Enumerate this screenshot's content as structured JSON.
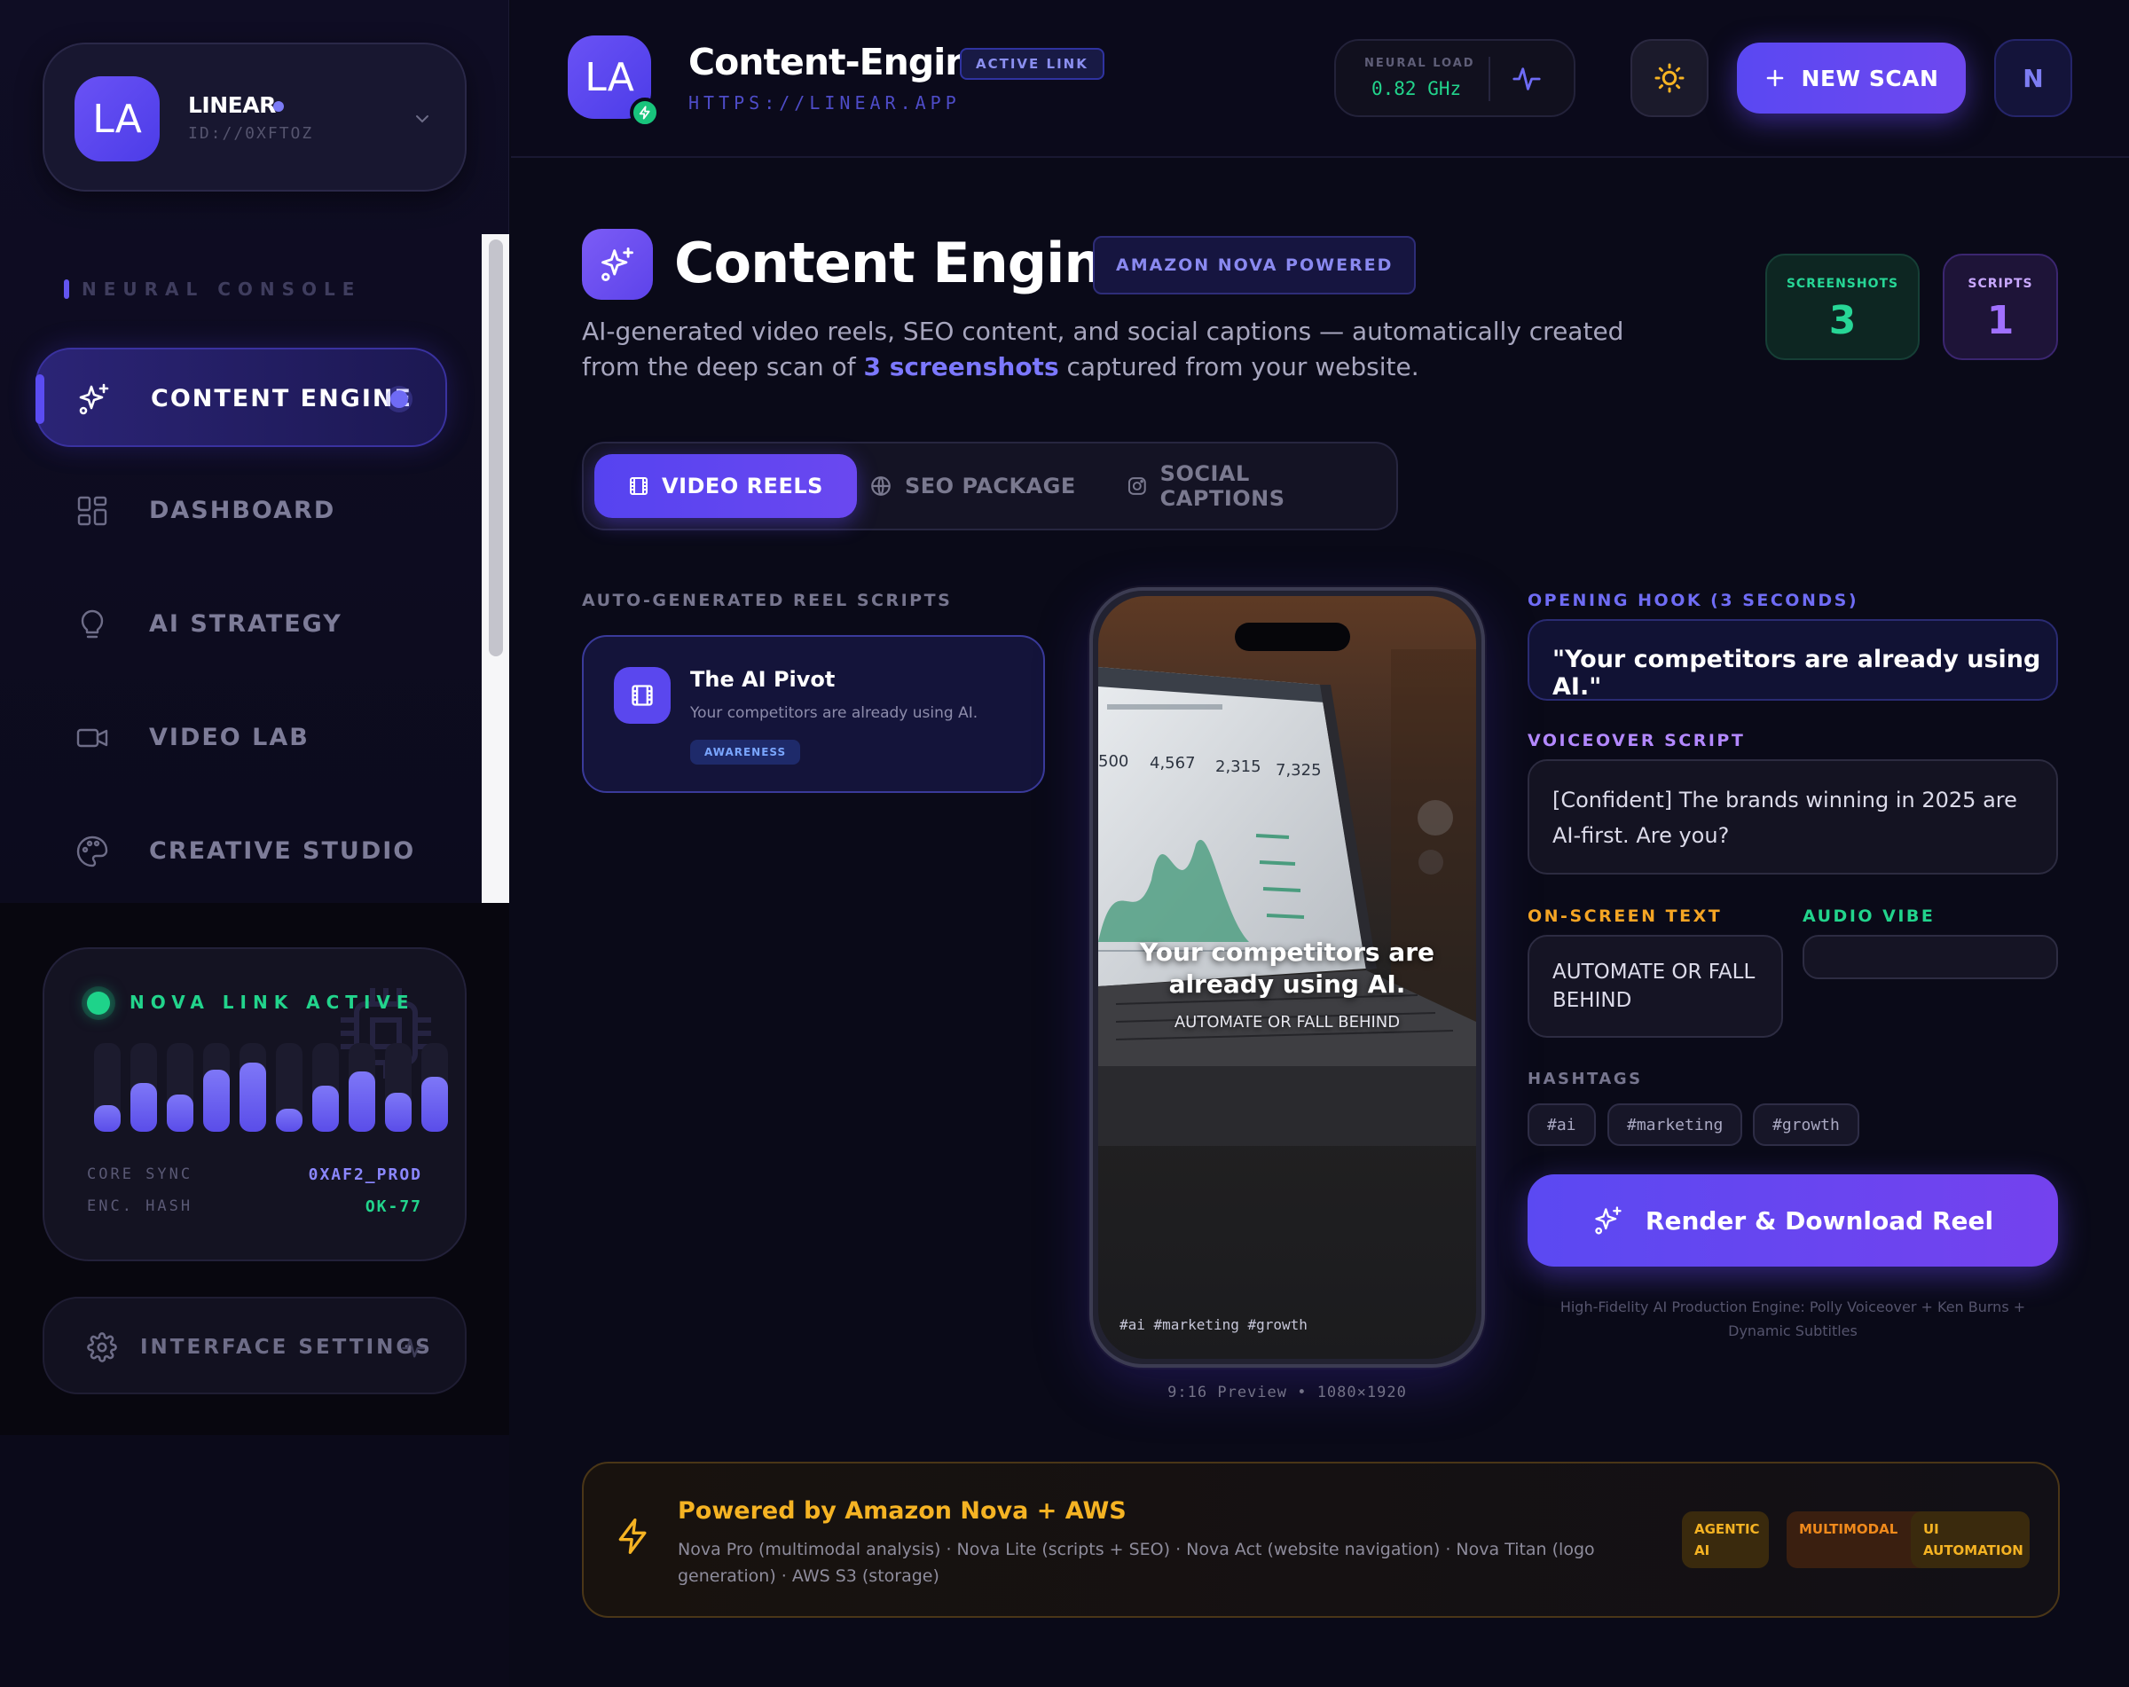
{
  "workspace": {
    "initials": "LA",
    "name": "LINEAR",
    "id": "ID://0XFTOZ"
  },
  "nav": {
    "heading": "NEURAL CONSOLE",
    "items": [
      {
        "label": "CONTENT ENGINE",
        "icon": "sparkles-icon",
        "active": true
      },
      {
        "label": "DASHBOARD",
        "icon": "grid-icon"
      },
      {
        "label": "AI STRATEGY",
        "icon": "lightbulb-icon"
      },
      {
        "label": "VIDEO LAB",
        "icon": "video-camera-icon"
      },
      {
        "label": "CREATIVE STUDIO",
        "icon": "palette-icon"
      }
    ]
  },
  "nova": {
    "status": "NOVA LINK ACTIVE",
    "levels": [
      0.3,
      0.55,
      0.42,
      0.7,
      0.78,
      0.26,
      0.52,
      0.68,
      0.44,
      0.62
    ],
    "rows": [
      {
        "key": "CORE SYNC",
        "value": "0XAF2_PROD",
        "color": "#8b87ff"
      },
      {
        "key": "ENC. HASH",
        "value": "OK-77",
        "color": "#22d48c"
      }
    ]
  },
  "settings": {
    "label": "INTERFACE SETTINGS"
  },
  "topbar": {
    "initials": "LA",
    "title": "Content-Engine",
    "status_pill": "ACTIVE LINK",
    "url": "HTTPS://LINEAR.APP",
    "neural_load_label": "NEURAL LOAD",
    "neural_load_value": "0.82 GHz",
    "new_scan_label": "NEW SCAN",
    "user_initial": "N"
  },
  "hero": {
    "title": "Content Engine",
    "pill": "AMAZON NOVA POWERED",
    "desc_before": "AI-generated video reels, SEO content, and social captions — automatically created from the deep scan of ",
    "desc_highlight": "3 screenshots",
    "desc_after": " captured from your website.",
    "stats": [
      {
        "label": "SCREENSHOTS",
        "value": "3"
      },
      {
        "label": "SCRIPTS",
        "value": "1"
      }
    ]
  },
  "tabs": [
    {
      "label": "VIDEO REELS",
      "icon": "film-icon",
      "active": true
    },
    {
      "label": "SEO PACKAGE",
      "icon": "globe-icon"
    },
    {
      "label": "SOCIAL CAPTIONS",
      "icon": "instagram-icon"
    }
  ],
  "scripts": {
    "heading": "AUTO-GENERATED REEL SCRIPTS",
    "items": [
      {
        "title": "The AI Pivot",
        "subtitle": "Your competitors are already using AI.",
        "tag": "AWARENESS"
      }
    ]
  },
  "preview": {
    "dashboard_numbers": [
      "500",
      "4,567",
      "2,315",
      "7,325"
    ],
    "overlay_title": "Your competitors are already using AI.",
    "overlay_sub": "AUTOMATE OR FALL BEHIND",
    "hashtags_line": "#ai #marketing #growth",
    "caption": "9:16 Preview • 1080×1920"
  },
  "detail": {
    "hook_label": "OPENING HOOK (3 SECONDS)",
    "hook_text": "\"Your competitors are already using AI.\"",
    "vo_label": "VOICEOVER SCRIPT",
    "vo_text": "[Confident] The brands winning in 2025 are AI-first. Are you?",
    "ost_label": "ON-SCREEN TEXT",
    "ost_text": "AUTOMATE OR FALL BEHIND",
    "audio_label": "AUDIO VIBE",
    "audio_value": "",
    "hashtags_label": "HASHTAGS",
    "hashtags": [
      "#ai",
      "#marketing",
      "#growth"
    ],
    "render_label": "Render & Download Reel",
    "render_note": "High-Fidelity AI Production Engine: Polly Voiceover + Ken Burns + Dynamic Subtitles"
  },
  "banner": {
    "title": "Powered by Amazon Nova + AWS",
    "desc": "Nova Pro (multimodal analysis) · Nova Lite (scripts + SEO) · Nova Act (website navigation) · Nova Titan (logo generation) · AWS S3 (storage)",
    "chips": [
      {
        "label": "AGENTIC AI",
        "color": "#f5b323"
      },
      {
        "label": "MULTIMODAL",
        "color": "#f08a1c"
      },
      {
        "label": "UI AUTOMATION",
        "color": "#f5b323"
      }
    ]
  },
  "colors": {
    "accent": "#5b49f2",
    "accent_light": "#7c78ff",
    "success": "#22d48c",
    "warning": "#f5b323",
    "background": "#0a0a18"
  }
}
